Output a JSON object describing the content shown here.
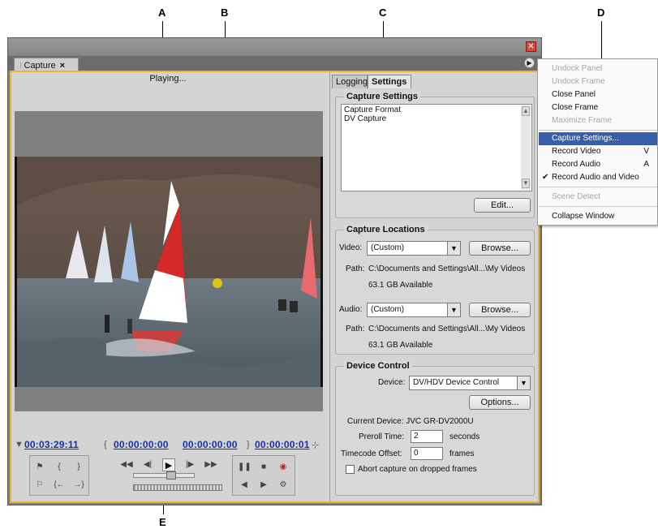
{
  "callouts": {
    "a": "A",
    "b": "B",
    "c": "C",
    "d": "D",
    "e": "E"
  },
  "window": {
    "close_glyph": "✕"
  },
  "panel": {
    "tab_label": "Capture",
    "tab_close": "×",
    "menu_icon": "panel-menu-icon"
  },
  "monitor": {
    "status": "Playing..."
  },
  "timecodes": {
    "current": "00:03:29:11",
    "in_point": "00:00:00:00",
    "out_point": "00:00:00:00",
    "duration": "00:00:00:01"
  },
  "tabs": [
    "Logging",
    "Settings"
  ],
  "capture_settings": {
    "title": "Capture Settings",
    "lines": [
      "Capture Format",
      "DV Capture"
    ],
    "edit_button": "Edit..."
  },
  "capture_locations": {
    "title": "Capture Locations",
    "video_label": "Video:",
    "video_value": "(Custom)",
    "video_path_label": "Path:",
    "video_path": "C:\\Documents and Settings\\All...\\My Videos",
    "video_available": "63.1 GB Available",
    "audio_label": "Audio:",
    "audio_value": "(Custom)",
    "audio_path_label": "Path:",
    "audio_path": "C:\\Documents and Settings\\All...\\My Videos",
    "audio_available": "63.1 GB Available",
    "browse_button": "Browse..."
  },
  "device_control": {
    "title": "Device Control",
    "device_label": "Device:",
    "device_value": "DV/HDV Device Control",
    "options_button": "Options...",
    "current_device": "Current Device:  JVC GR-DV2000U",
    "preroll_label": "Preroll Time:",
    "preroll_value": "2",
    "preroll_unit": "seconds",
    "offset_label": "Timecode Offset:",
    "offset_value": "0",
    "offset_unit": "frames",
    "abort_label": "Abort capture on dropped frames"
  },
  "menu": {
    "items": [
      {
        "label": "Undock Panel",
        "enabled": false
      },
      {
        "label": "Undock Frame",
        "enabled": false
      },
      {
        "label": "Close Panel",
        "enabled": true
      },
      {
        "label": "Close Frame",
        "enabled": true
      },
      {
        "label": "Maximize Frame",
        "enabled": false
      },
      {
        "label": "Capture Settings...",
        "enabled": true,
        "selected": true
      },
      {
        "label": "Record Video",
        "enabled": true,
        "shortcut": "V"
      },
      {
        "label": "Record Audio",
        "enabled": true,
        "shortcut": "A"
      },
      {
        "label": "Record Audio and Video",
        "enabled": true,
        "checked": true
      },
      {
        "label": "Scene Detect",
        "enabled": false
      },
      {
        "label": "Collapse Window",
        "enabled": true
      }
    ]
  },
  "colors": {
    "accent_border": "#e8b43a",
    "menu_highlight": "#3a5ea8",
    "timecode": "#1b2fa8"
  }
}
